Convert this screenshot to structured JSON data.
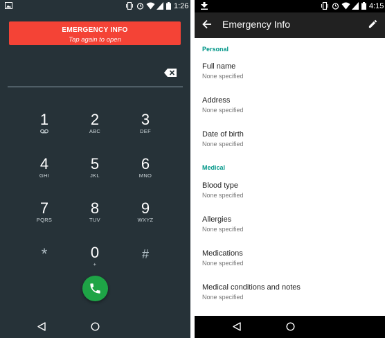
{
  "left": {
    "status": {
      "time": "1:26"
    },
    "banner": {
      "title": "EMERGENCY INFO",
      "subtitle": "Tap again to open"
    },
    "keys": [
      {
        "digit": "1",
        "letters": ""
      },
      {
        "digit": "2",
        "letters": "ABC"
      },
      {
        "digit": "3",
        "letters": "DEF"
      },
      {
        "digit": "4",
        "letters": "GHI"
      },
      {
        "digit": "5",
        "letters": "JKL"
      },
      {
        "digit": "6",
        "letters": "MNO"
      },
      {
        "digit": "7",
        "letters": "PQRS"
      },
      {
        "digit": "8",
        "letters": "TUV"
      },
      {
        "digit": "9",
        "letters": "WXYZ"
      },
      {
        "digit": "*",
        "letters": ""
      },
      {
        "digit": "0",
        "letters": "+"
      },
      {
        "digit": "#",
        "letters": ""
      }
    ],
    "icons": [
      "image-icon",
      "vibrate-icon",
      "alarm-icon",
      "wifi-icon",
      "signal-icon",
      "battery-icon",
      "backspace-icon",
      "voicemail-icon",
      "phone-icon",
      "back-icon",
      "home-icon"
    ],
    "colors": {
      "background": "#263238",
      "banner": "#f44336",
      "call": "#1ea446"
    }
  },
  "right": {
    "status": {
      "time": "4:15"
    },
    "appbar": {
      "title": "Emergency Info"
    },
    "sections": [
      {
        "header": "Personal",
        "items": [
          {
            "name": "Full name",
            "value": "None specified"
          },
          {
            "name": "Address",
            "value": "None specified"
          },
          {
            "name": "Date of birth",
            "value": "None specified"
          }
        ]
      },
      {
        "header": "Medical",
        "items": [
          {
            "name": "Blood type",
            "value": "None specified"
          },
          {
            "name": "Allergies",
            "value": "None specified"
          },
          {
            "name": "Medications",
            "value": "None specified"
          },
          {
            "name": "Medical conditions and notes",
            "value": "None specified"
          }
        ]
      }
    ],
    "icons": [
      "download-icon",
      "vibrate-icon",
      "alarm-icon",
      "wifi-icon",
      "signal-icon",
      "battery-icon",
      "arrow-back-icon",
      "edit-icon",
      "back-icon",
      "home-icon"
    ],
    "colors": {
      "appbar": "#212121",
      "section": "#009688"
    }
  }
}
